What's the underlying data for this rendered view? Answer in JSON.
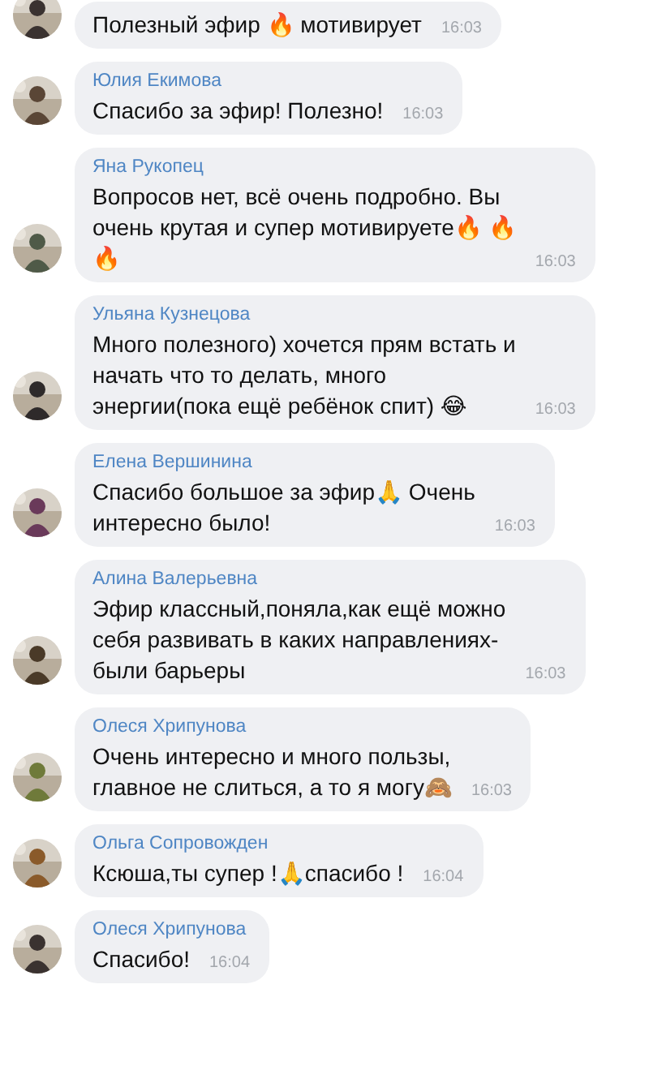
{
  "messages": [
    {
      "text": "Полезный эфир 🔥 мотивирует",
      "time": "16:03"
    },
    {
      "author": "Юлия Екимова",
      "text": "Спасибо за эфир! Полезно!",
      "time": "16:03"
    },
    {
      "author": "Яна Рукопец",
      "text": "Вопросов нет, всё очень подробно. Вы\nочень крутая и супер мотивируете🔥 🔥\n🔥",
      "time": "16:03"
    },
    {
      "author": "Ульяна Кузнецова",
      "text": "Много полезного) хочется прям встать и\nначать что то делать, много\nэнергии(пока ещё ребёнок спит) 😂",
      "time": "16:03"
    },
    {
      "author": "Елена Вершинина",
      "text": "Спасибо большое за эфир🙏 Очень\nинтересно было!",
      "time": "16:03"
    },
    {
      "author": "Алина Валерьевна",
      "text": "Эфир классный,поняла,как ещё можно\nсебя развивать в каких направлениях-\nбыли барьеры",
      "time": "16:03"
    },
    {
      "author": "Олеся Хрипунова",
      "text": "Очень интересно и много пользы,\nглавное не слиться, а то я могу🙈",
      "time": "16:03"
    },
    {
      "author": "Ольга Сопровожден",
      "text": "Ксюша,ты супер !🙏спасибо !",
      "time": "16:04"
    },
    {
      "author": "Олеся Хрипунова",
      "text": "Спасибо!",
      "time": "16:04"
    }
  ]
}
